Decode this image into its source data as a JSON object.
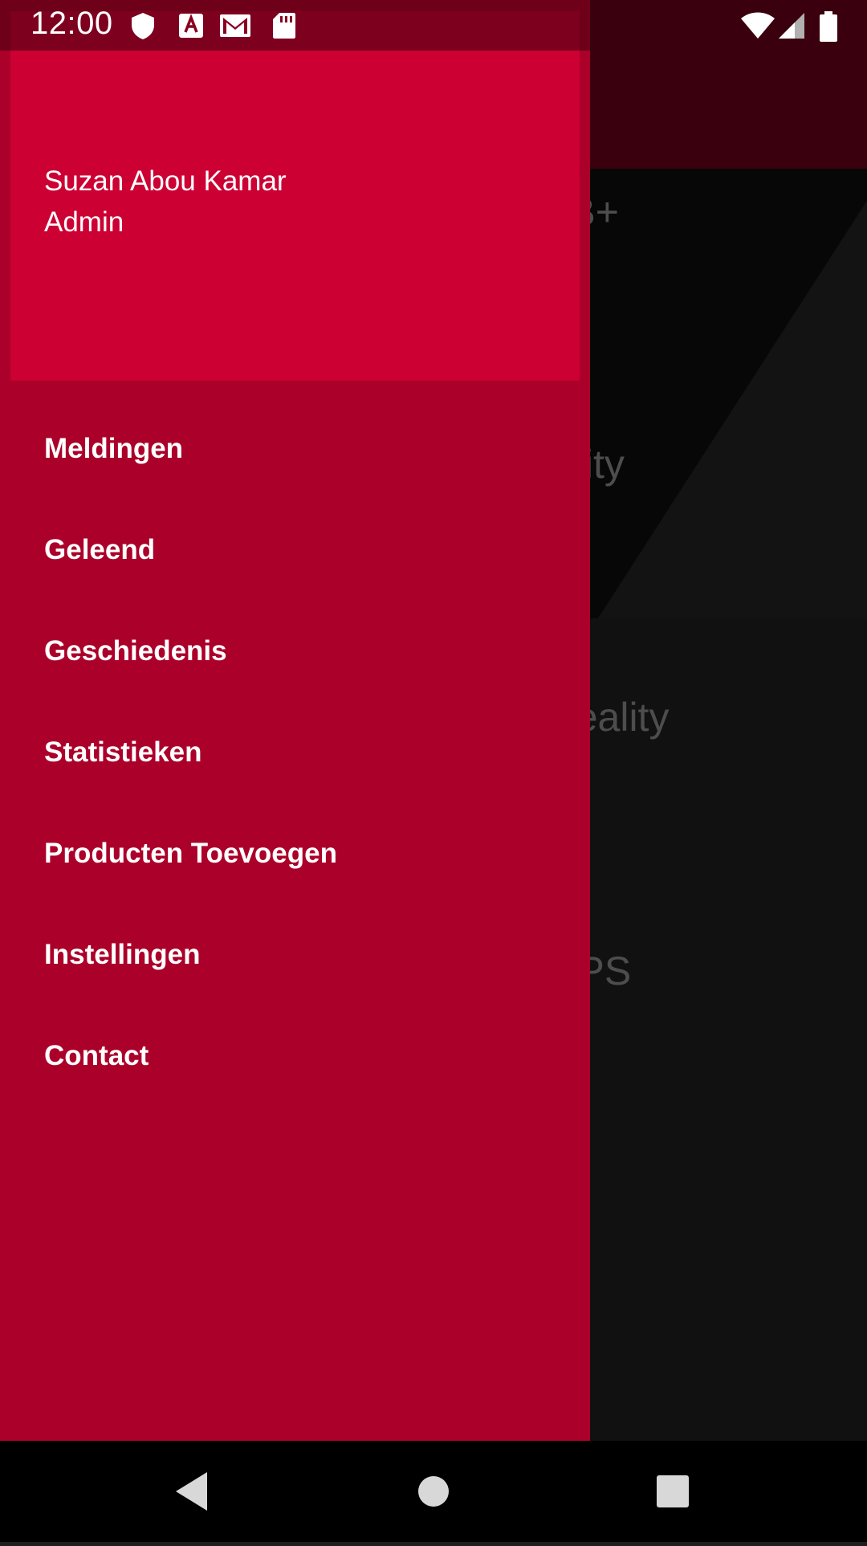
{
  "status_bar": {
    "time": "12:00",
    "left_icons": [
      "shield-icon",
      "font-a-icon",
      "mail-icon",
      "sd-card-icon"
    ],
    "right_icons": [
      "wifi-icon",
      "cell-signal-icon",
      "battery-icon"
    ]
  },
  "drawer": {
    "header": {
      "name": "Suzan Abou Kamar",
      "role": "Admin"
    },
    "menu": [
      {
        "label": "Meldingen"
      },
      {
        "label": "Geleend"
      },
      {
        "label": "Geschiedenis"
      },
      {
        "label": "Statistieken"
      },
      {
        "label": "Producten Toevoegen"
      },
      {
        "label": "Instellingen"
      },
      {
        "label": "Contact"
      }
    ]
  },
  "background_list": {
    "items": [
      {
        "text": "odel B+"
      },
      {
        "text": "l Reality"
      },
      {
        "text": "ual Reality"
      },
      {
        "text": "bel GPS\ne"
      }
    ]
  },
  "system_nav": {
    "icons": [
      "back-icon",
      "home-icon",
      "recents-icon"
    ]
  },
  "colors": {
    "drawer_bg": "#ab0029",
    "header_bg": "#cc0033",
    "toolbar_bg": "#6c0018"
  }
}
